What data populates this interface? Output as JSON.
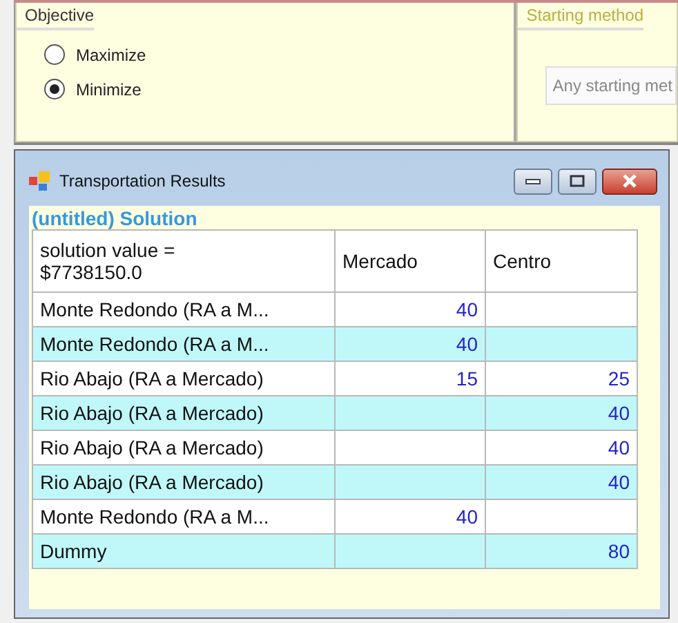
{
  "objective": {
    "title": "Objective",
    "options": [
      {
        "label": "Maximize",
        "selected": false
      },
      {
        "label": "Minimize",
        "selected": true
      }
    ]
  },
  "starting_method": {
    "title": "Starting method",
    "disabled": true,
    "value": "Any starting met"
  },
  "window": {
    "title": "Transportation Results"
  },
  "solution": {
    "title": "(untitled) Solution",
    "columns": [
      "solution value =\n$7738150.0",
      "Mercado",
      "Centro"
    ],
    "rows": [
      {
        "name": "Monte Redondo (RA a M...",
        "mercado": "40"
      },
      {
        "name": "Monte Redondo (RA a M...",
        "mercado": "40"
      },
      {
        "name": "Rio Abajo (RA a Mercado)",
        "mercado": "15",
        "centro": "25"
      },
      {
        "name": "Rio Abajo (RA a Mercado)",
        "centro": "40"
      },
      {
        "name": "Rio Abajo (RA a Mercado)",
        "centro": "40"
      },
      {
        "name": "Rio Abajo (RA a Mercado)",
        "centro": "40"
      },
      {
        "name": "Monte Redondo (RA a M...",
        "mercado": "40"
      },
      {
        "name": "Dummy",
        "centro": "80"
      }
    ]
  }
}
